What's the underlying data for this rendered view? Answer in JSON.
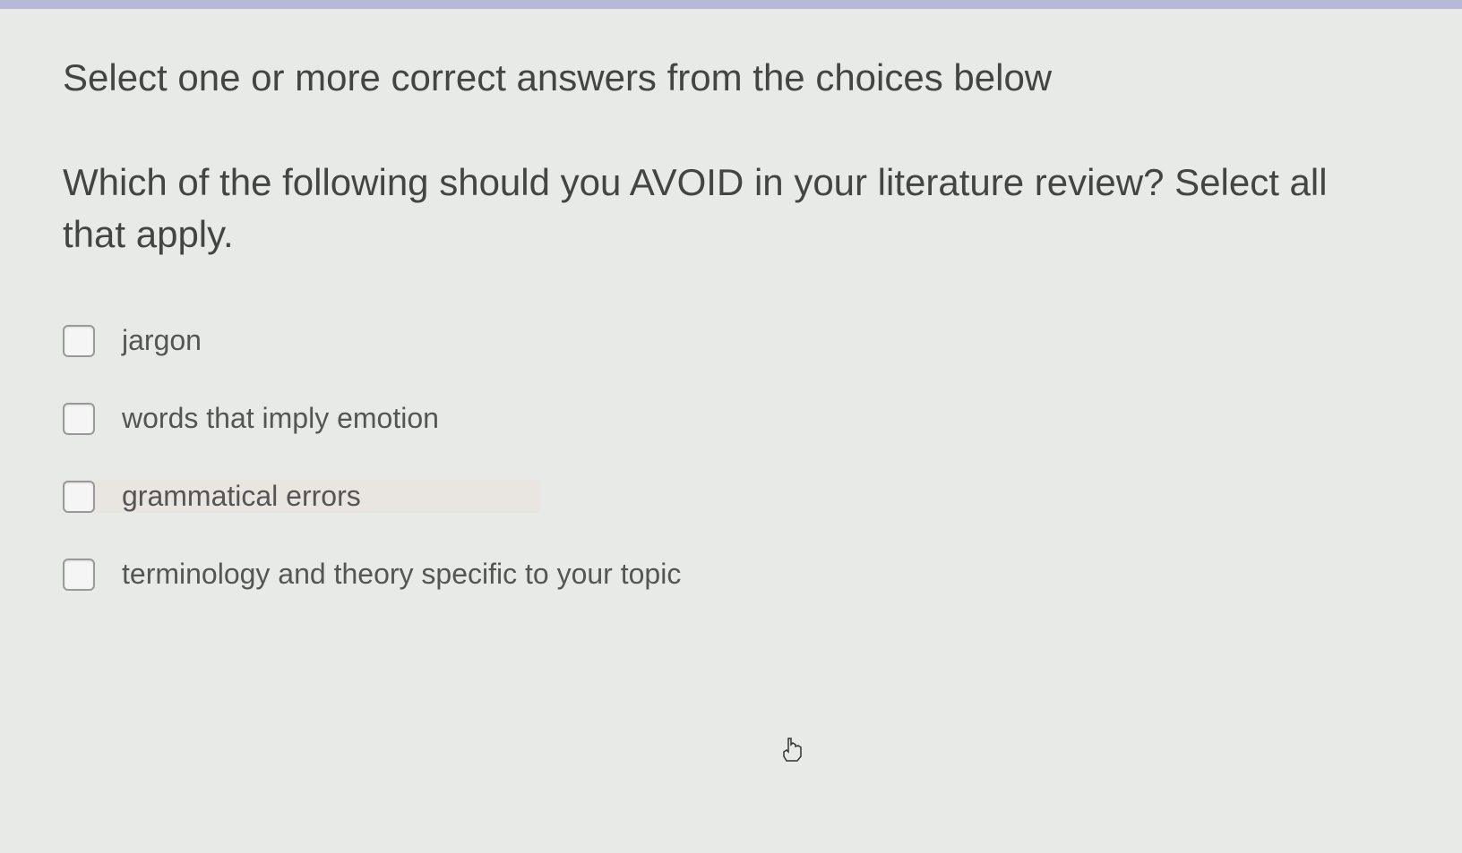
{
  "instruction": "Select one or more correct answers from the choices below",
  "question": "Which of the following should you AVOID in your literature review?  Select all that apply.",
  "options": [
    {
      "label": "jargon",
      "checked": false,
      "hover": false
    },
    {
      "label": "words that imply emotion",
      "checked": false,
      "hover": false
    },
    {
      "label": "grammatical errors",
      "checked": false,
      "hover": true
    },
    {
      "label": "terminology and theory specific to your topic",
      "checked": false,
      "hover": false
    }
  ]
}
